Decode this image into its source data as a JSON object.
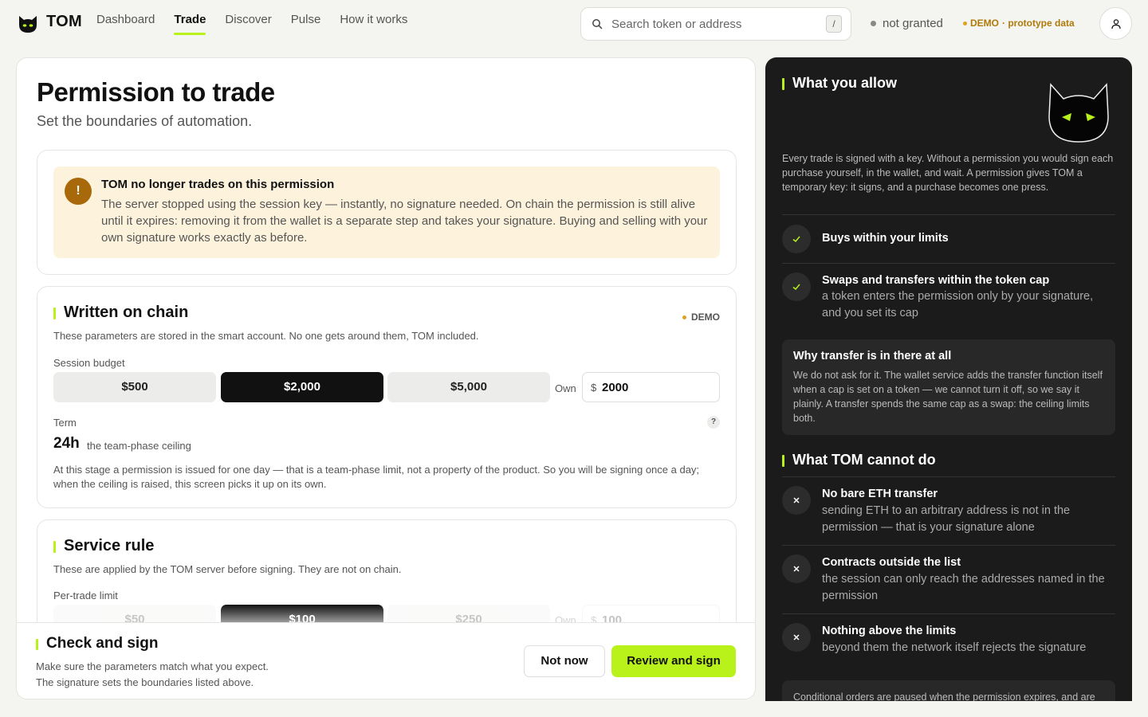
{
  "app": {
    "brand": "TOM"
  },
  "nav": {
    "items": [
      "Dashboard",
      "Trade",
      "Discover",
      "Pulse",
      "How it works"
    ],
    "active": "Trade"
  },
  "search": {
    "placeholder": "Search token or address",
    "shortcut": "/"
  },
  "status": {
    "permission": "not granted",
    "demo_label": "DEMO",
    "demo_note": "· prototype data"
  },
  "page": {
    "title": "Permission to trade",
    "subtitle": "Set the boundaries of automation."
  },
  "notice": {
    "icon": "!",
    "title": "TOM no longer trades on this permission",
    "text": "The server stopped using the session key — instantly, no signature needed. On chain the permission is still alive until it expires: removing it from the wallet is a separate step and takes your signature. Buying and selling with your own signature works exactly as before."
  },
  "chain": {
    "title": "Written on chain",
    "demo": "DEMO",
    "desc": "These parameters are stored in the smart account. No one gets around them, TOM included.",
    "budget_label": "Session budget",
    "budget_options": [
      "$500",
      "$2,000",
      "$5,000"
    ],
    "selected_budget": "$2,000",
    "own_label": "Own",
    "currency": "$",
    "own_value": "2000",
    "term_label": "Term",
    "term_help": "?",
    "term_value": "24h",
    "term_note": "the team-phase ceiling",
    "term_desc": "At this stage a permission is issued for one day — that is a team-phase limit, not a property of the product. So you will be signing once a day; when the ceiling is raised, this screen picks it up on its own."
  },
  "rule": {
    "title": "Service rule",
    "desc": "These are applied by the TOM server before signing. They are not on chain.",
    "per_trade_label": "Per-trade limit",
    "options": [
      "$50",
      "$100",
      "$250"
    ],
    "selected": "$100",
    "own_label": "Own",
    "currency": "$",
    "own_value": "100"
  },
  "footer": {
    "title": "Check and sign",
    "line1": "Make sure the parameters match what you expect.",
    "line2": "The signature sets the boundaries listed above.",
    "secondary": "Not now",
    "primary": "Review and sign"
  },
  "panel": {
    "allow_title": "What you allow",
    "intro": "Every trade is signed with a key. Without a permission you would sign each purchase yourself, in the wallet, and wait. A permission gives TOM a temporary key: it signs, and a purchase becomes one press.",
    "allows": [
      {
        "title": "Buys within your limits",
        "sub": ""
      },
      {
        "title": "Swaps and transfers within the token cap",
        "sub": "a token enters the permission only by your signature, and you set its cap"
      }
    ],
    "why_title": "Why transfer is in there at all",
    "why_text": "We do not ask for it. The wallet service adds the transfer function itself when a cap is set on a token — we cannot turn it off, so we say it plainly. A transfer spends the same cap as a swap: the ceiling limits both.",
    "cannot_title": "What TOM cannot do",
    "cannots": [
      {
        "title": "No bare ETH transfer",
        "sub": "sending ETH to an arbitrary address is not in the permission — that is your signature alone"
      },
      {
        "title": "Contracts outside the list",
        "sub": "the session can only reach the addresses named in the permission"
      },
      {
        "title": "Nothing above the limits",
        "sub": "beyond them the network itself rejects the signature"
      }
    ],
    "bottom_note": "Conditional orders are paused when the permission expires, and are"
  },
  "colors": {
    "accent": "#b9f21a",
    "dark_panel": "#1b1b1b",
    "notice_bg": "#fdf3dc",
    "notice_icon": "#a8690a",
    "demo": "#b07a0a"
  }
}
